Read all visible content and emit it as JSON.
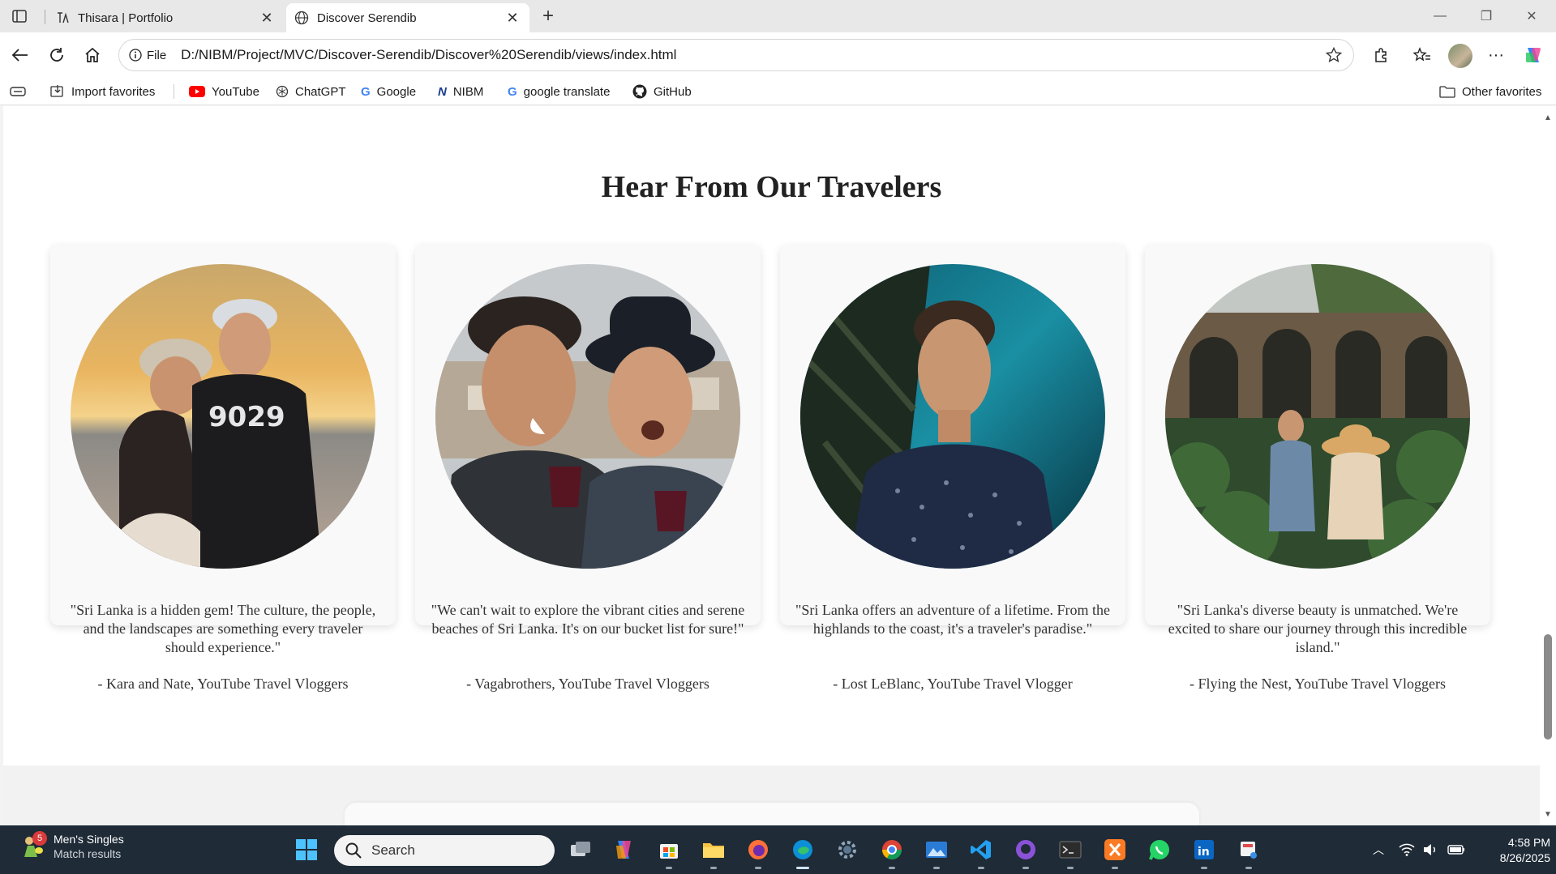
{
  "browser": {
    "tabs": [
      {
        "title": "Thisara | Portfolio",
        "favicon": "font-glyph-icon",
        "active": false
      },
      {
        "title": "Discover Serendib",
        "favicon": "globe-icon",
        "active": true
      }
    ],
    "address": {
      "scheme_label": "File",
      "url": "D:/NIBM/Project/MVC/Discover-Serendib/Discover%20Serendib/views/index.html"
    },
    "favorites": [
      {
        "label": "Import favorites",
        "icon": "import-icon"
      },
      {
        "label": "YouTube",
        "icon": "youtube-icon"
      },
      {
        "label": "ChatGPT",
        "icon": "chatgpt-icon"
      },
      {
        "label": "Google",
        "icon": "google-icon"
      },
      {
        "label": "NIBM",
        "icon": "nibm-icon"
      },
      {
        "label": "google translate",
        "icon": "google-icon"
      },
      {
        "label": "GitHub",
        "icon": "github-icon"
      }
    ],
    "other_favorites": "Other favorites"
  },
  "page": {
    "section_title": "Hear From Our Travelers",
    "testimonials": [
      {
        "quote": "\"Sri Lanka is a hidden gem! The culture, the people, and the landscapes are something every traveler should experience.\"",
        "author": "- Kara and Nate, YouTube Travel Vloggers"
      },
      {
        "quote": "\"We can't wait to explore the vibrant cities and serene beaches of Sri Lanka. It's on our bucket list for sure!\"",
        "author": "- Vagabrothers, YouTube Travel Vloggers"
      },
      {
        "quote": "\"Sri Lanka offers an adventure of a lifetime. From the highlands to the coast, it's a traveler's paradise.\"",
        "author": "- Lost LeBlanc, YouTube Travel Vlogger"
      },
      {
        "quote": "\"Sri Lanka's diverse beauty is unmatched. We're excited to share our journey through this incredible island.\"",
        "author": "- Flying the Nest, YouTube Travel Vloggers"
      }
    ]
  },
  "taskbar": {
    "widget": {
      "badge": "5",
      "title": "Men's Singles",
      "subtitle": "Match results"
    },
    "search_placeholder": "Search",
    "time": "4:58 PM",
    "date": "8/26/2025"
  },
  "colors": {
    "taskbar_bg": "#1f2b37",
    "card_bg": "#f9f9f9",
    "title_text": "#222222"
  }
}
